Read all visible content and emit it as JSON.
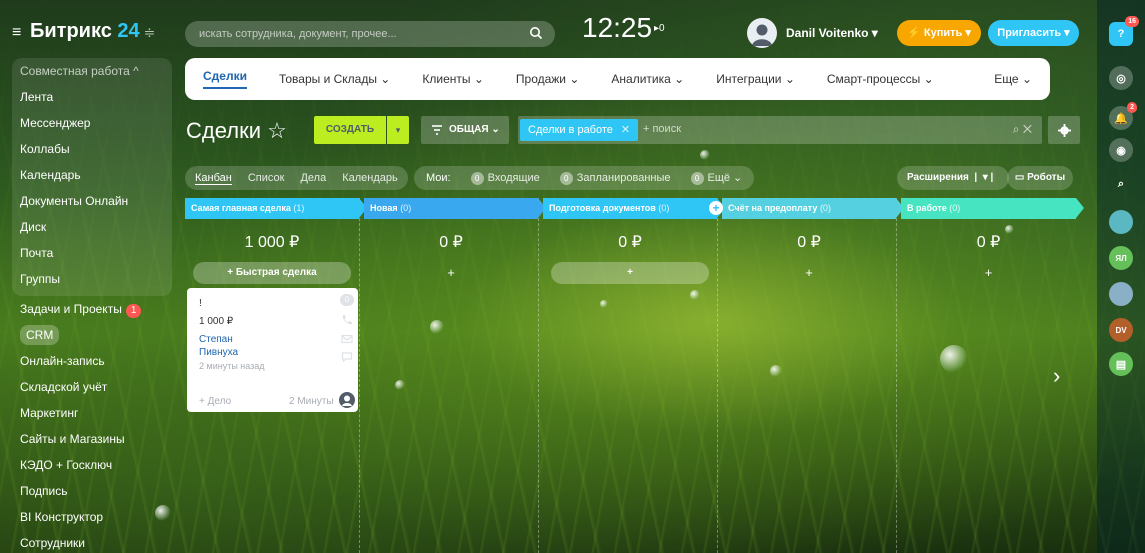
{
  "header": {
    "logo_main": "Битрикс",
    "logo_num": "24",
    "logo_hint": "≑",
    "search_placeholder": "искать сотрудника, документ, прочее...",
    "clock": "12:25",
    "flag_count": "▸0",
    "user_name": "Danil Voitenko ▾",
    "buy_label": "Купить",
    "invite_label": "Пригласить"
  },
  "sidebar": {
    "group_label": "Совместная работа ^",
    "group_items": [
      "Лента",
      "Мессенджер",
      "Коллабы",
      "Календарь",
      "Документы Онлайн",
      "Диск",
      "Почта",
      "Группы"
    ],
    "items": [
      {
        "label": "Задачи и Проекты",
        "badge": "1"
      },
      {
        "label": "CRM"
      },
      {
        "label": "Онлайн-запись"
      },
      {
        "label": "Складской учёт"
      },
      {
        "label": "Маркетинг"
      },
      {
        "label": "Сайты и Магазины"
      },
      {
        "label": "КЭДО + Госключ"
      },
      {
        "label": "Подпись"
      },
      {
        "label": "BI Конструктор"
      },
      {
        "label": "Сотрудники"
      }
    ]
  },
  "topnav": {
    "tabs": [
      "Сделки",
      "Товары и Склады ⌄",
      "Клиенты ⌄",
      "Продажи ⌄",
      "Аналитика ⌄",
      "Интеграции ⌄",
      "Смарт-процессы ⌄"
    ],
    "more": "Еще ⌄"
  },
  "toolbar": {
    "title": "Сделки ☆",
    "create_label": "СОЗДАТЬ",
    "filter_label": "ОБЩАЯ ⌄",
    "filter_chip": "Сделки в работе",
    "filter_placeholder": "+ поиск"
  },
  "views": {
    "tabs": [
      "Канбан",
      "Список",
      "Дела",
      "Календарь"
    ],
    "counters_label": "Мои:",
    "counters": [
      {
        "value": "0",
        "label": "Входящие"
      },
      {
        "value": "0",
        "label": "Запланированные"
      },
      {
        "value": "0",
        "label": "Ещё ⌄"
      }
    ],
    "extensions_label": "Расширения",
    "robots_label": "Роботы"
  },
  "kanban": {
    "columns": [
      {
        "title": "Самая главная сделка",
        "count": "(1)",
        "sum": "1 000 ₽",
        "color": "#2fc6f6",
        "add": "+ Быстрая сделка"
      },
      {
        "title": "Новая",
        "count": "(0)",
        "sum": "0 ₽",
        "color": "#39a8ef",
        "add": "+"
      },
      {
        "title": "Подготовка документов",
        "count": "(0)",
        "sum": "0 ₽",
        "color": "#2fc6f6",
        "add": "+"
      },
      {
        "title": "Счёт на предоплату",
        "count": "(0)",
        "sum": "0 ₽",
        "color": "#55d0e0",
        "add": "+"
      },
      {
        "title": "В работе",
        "count": "(0)",
        "sum": "0 ₽",
        "color": "#47e4c2",
        "add": "+"
      }
    ],
    "card": {
      "title": "!",
      "sum": "1 000 ₽",
      "contact1": "Степан",
      "contact2": "Пивнуха",
      "ago": "2 минуты назад",
      "add_task": "+ Дело",
      "minutes": "2 Минуты",
      "counter": "0"
    }
  },
  "rightbar": {
    "help_badge": "16",
    "bell_badge": "2",
    "avatar1": "ЯЛ",
    "avatar2": "DV"
  }
}
